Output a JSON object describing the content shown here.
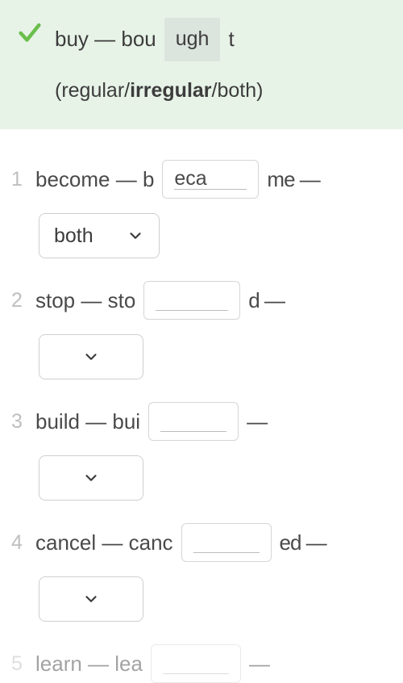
{
  "example": {
    "prefix": "buy — bou",
    "chip": "ugh",
    "suffix": "t",
    "hint_open": "(regular/",
    "hint_bold": "irregular",
    "hint_close": "/both)"
  },
  "questions": [
    {
      "num": "1",
      "prefix": "become — b",
      "blank_value": "eca",
      "suffix": "me —",
      "dropdown_value": "both"
    },
    {
      "num": "2",
      "prefix": "stop — sto",
      "blank_value": "",
      "suffix": "d —",
      "dropdown_value": ""
    },
    {
      "num": "3",
      "prefix": "build — bui",
      "blank_value": "",
      "suffix": "—",
      "dropdown_value": ""
    },
    {
      "num": "4",
      "prefix": "cancel — canc",
      "blank_value": "",
      "suffix": "ed —",
      "dropdown_value": ""
    },
    {
      "num": "5",
      "prefix": "learn — lea",
      "blank_value": "",
      "suffix": "—",
      "dropdown_value": ""
    }
  ]
}
